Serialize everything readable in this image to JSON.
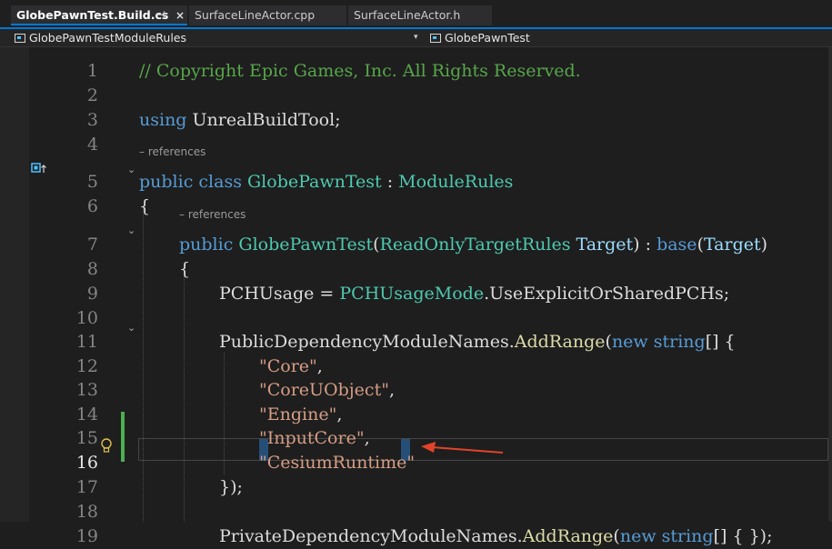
{
  "tabs": [
    {
      "label": "GlobePawnTest.Build.cs",
      "pin": "⊣",
      "close": "×"
    },
    {
      "label": "SurfaceLineActor.cpp"
    },
    {
      "label": "SurfaceLineActor.h"
    }
  ],
  "nav": {
    "left": {
      "label": "GlobePawnTestModuleRules",
      "icon": "class-icon"
    },
    "right": {
      "label": "GlobePawnTest",
      "icon": "class-icon"
    }
  },
  "lens": {
    "references": "– references"
  },
  "lines": [
    {
      "n": "1",
      "tokens": [
        {
          "t": "// Copyright Epic Games, Inc. All Rights Reserved.",
          "c": "cm"
        }
      ]
    },
    {
      "n": "2",
      "tokens": []
    },
    {
      "n": "3",
      "tokens": [
        {
          "t": "using",
          "c": "kw"
        },
        {
          "t": " UnrealBuildTool;",
          "c": "tx"
        }
      ]
    },
    {
      "n": "4",
      "tokens": []
    },
    {
      "n": "5",
      "tokens": [
        {
          "t": "public",
          "c": "kw"
        },
        {
          "t": " ",
          "c": "tx"
        },
        {
          "t": "class",
          "c": "kw"
        },
        {
          "t": " ",
          "c": "tx"
        },
        {
          "t": "GlobePawnTest",
          "c": "ty"
        },
        {
          "t": " : ",
          "c": "tx"
        },
        {
          "t": "ModuleRules",
          "c": "ty"
        }
      ]
    },
    {
      "n": "6",
      "tokens": [
        {
          "t": "{",
          "c": "tx"
        }
      ]
    },
    {
      "n": "7",
      "tokens": [
        {
          "t": "public",
          "c": "kw"
        },
        {
          "t": " ",
          "c": "tx"
        },
        {
          "t": "GlobePawnTest",
          "c": "ty"
        },
        {
          "t": "(",
          "c": "tx"
        },
        {
          "t": "ReadOnlyTargetRules",
          "c": "ty"
        },
        {
          "t": " ",
          "c": "tx"
        },
        {
          "t": "Target",
          "c": "pm"
        },
        {
          "t": ") : ",
          "c": "tx"
        },
        {
          "t": "base",
          "c": "kw"
        },
        {
          "t": "(",
          "c": "tx"
        },
        {
          "t": "Target",
          "c": "pm"
        },
        {
          "t": ")",
          "c": "tx"
        }
      ]
    },
    {
      "n": "8",
      "tokens": [
        {
          "t": "{",
          "c": "tx"
        }
      ]
    },
    {
      "n": "9",
      "tokens": [
        {
          "t": "PCHUsage = ",
          "c": "tx"
        },
        {
          "t": "PCHUsageMode",
          "c": "ty"
        },
        {
          "t": ".UseExplicitOrSharedPCHs;",
          "c": "tx"
        }
      ]
    },
    {
      "n": "10",
      "tokens": []
    },
    {
      "n": "11",
      "tokens": [
        {
          "t": "PublicDependencyModuleNames.",
          "c": "tx"
        },
        {
          "t": "AddRange",
          "c": "fn"
        },
        {
          "t": "(",
          "c": "tx"
        },
        {
          "t": "new",
          "c": "kw"
        },
        {
          "t": " ",
          "c": "tx"
        },
        {
          "t": "string",
          "c": "kw"
        },
        {
          "t": "[] {",
          "c": "tx"
        }
      ]
    },
    {
      "n": "12",
      "tokens": [
        {
          "t": "\"Core\"",
          "c": "st"
        },
        {
          "t": ",",
          "c": "tx"
        }
      ]
    },
    {
      "n": "13",
      "tokens": [
        {
          "t": "\"CoreUObject\"",
          "c": "st"
        },
        {
          "t": ",",
          "c": "tx"
        }
      ]
    },
    {
      "n": "14",
      "tokens": [
        {
          "t": "\"Engine\"",
          "c": "st"
        },
        {
          "t": ",",
          "c": "tx"
        }
      ]
    },
    {
      "n": "15",
      "tokens": [
        {
          "t": "\"InputCore\"",
          "c": "st"
        },
        {
          "t": ",",
          "c": "tx"
        }
      ]
    },
    {
      "n": "16",
      "tokens": [
        {
          "t": "\"CesiumRuntime\"",
          "c": "st"
        }
      ]
    },
    {
      "n": "17",
      "tokens": [
        {
          "t": "});",
          "c": "tx"
        }
      ]
    },
    {
      "n": "18",
      "tokens": []
    },
    {
      "n": "19",
      "tokens": [
        {
          "t": "PrivateDependencyModuleNames.",
          "c": "tx"
        },
        {
          "t": "AddRange",
          "c": "fn"
        },
        {
          "t": "(",
          "c": "tx"
        },
        {
          "t": "new",
          "c": "kw"
        },
        {
          "t": " ",
          "c": "tx"
        },
        {
          "t": "string",
          "c": "kw"
        },
        {
          "t": "[] { });",
          "c": "tx"
        }
      ]
    }
  ],
  "colors": {
    "comment": "#57a64a",
    "keyword": "#569cd6",
    "type": "#4ec9b0",
    "string": "#d69d85",
    "annotation_arrow": "#e0442a",
    "change_bar": "#4caf50",
    "accent": "#0078d4"
  },
  "current_line": "16"
}
